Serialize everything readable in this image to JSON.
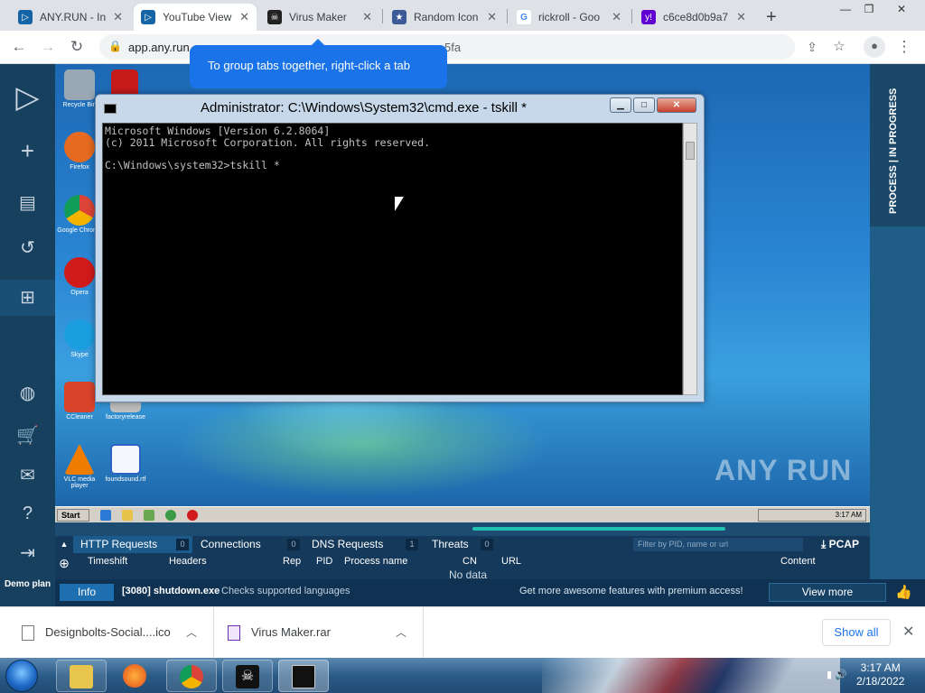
{
  "browser": {
    "tabs": [
      {
        "title": "ANY.RUN - In",
        "favicon": "anyrun-favicon",
        "active": false
      },
      {
        "title": "YouTube View",
        "favicon": "anyrun-favicon",
        "active": true
      },
      {
        "title": "Virus Maker",
        "favicon": "pirate-favicon",
        "active": false
      },
      {
        "title": "Random Icon",
        "favicon": "star-favicon",
        "active": false
      },
      {
        "title": "rickroll - Goo",
        "favicon": "google-favicon",
        "active": false
      },
      {
        "title": "c6ce8d0b9a7",
        "favicon": "yahoo-favicon",
        "active": false
      }
    ],
    "new_tab": "+",
    "url": "app.any.run",
    "url_tail": "5fa",
    "tooltip": "To group tabs together, right-click a tab"
  },
  "anyrun": {
    "sidebar_bottom_label": "Demo plan",
    "status_vertical": "PROCESS | IN PROGRESS",
    "watermark": "ANY RUN",
    "network": {
      "tabs": [
        {
          "label": "HTTP Requests",
          "count": "0"
        },
        {
          "label": "Connections",
          "count": "0"
        },
        {
          "label": "DNS Requests",
          "count": "1"
        },
        {
          "label": "Threats",
          "count": "0"
        }
      ],
      "filter_placeholder": "Filter by PID, name or url",
      "pcap_label": "PCAP",
      "columns": [
        "Timeshift",
        "Headers",
        "Rep",
        "PID",
        "Process name",
        "CN",
        "URL",
        "Content"
      ],
      "empty_text": "No data"
    },
    "info": {
      "button": "Info",
      "process": "[3080] shutdown.exe",
      "description": "Checks supported languages",
      "premium": "Get more awesome features with premium access!",
      "view_more": "View more"
    }
  },
  "vm": {
    "desktop_icons": [
      {
        "label": "Recycle Bin",
        "color": "#9aa7b5"
      },
      {
        "label": "Firefox",
        "color": "#e66a1f"
      },
      {
        "label": "Google Chrome",
        "color": "#3b9a45"
      },
      {
        "label": "Opera",
        "color": "#d11a1a"
      },
      {
        "label": "Skype",
        "color": "#1b9ee0"
      },
      {
        "label": "CCleaner",
        "color": "#d9432b"
      },
      {
        "label": "VLC media player",
        "color": "#f07c00"
      },
      {
        "label": "factoryrelease",
        "color": "#bdbdbd"
      },
      {
        "label": "foundsound.rtf",
        "color": "#2a62c6"
      }
    ],
    "cmd": {
      "title": "Administrator: C:\\Windows\\System32\\cmd.exe - tskill  *",
      "output": "Microsoft Windows [Version 6.2.8064]\n(c) 2011 Microsoft Corporation. All rights reserved.\n\nC:\\Windows\\system32>tskill *"
    },
    "start_label": "Start",
    "tray_time": "3:17 AM"
  },
  "downloads": {
    "items": [
      {
        "name": "Designbolts-Social....ico"
      },
      {
        "name": "Virus Maker.rar"
      }
    ],
    "show_all": "Show all"
  },
  "host_taskbar": {
    "time": "3:17 AM",
    "date": "2/18/2022"
  }
}
